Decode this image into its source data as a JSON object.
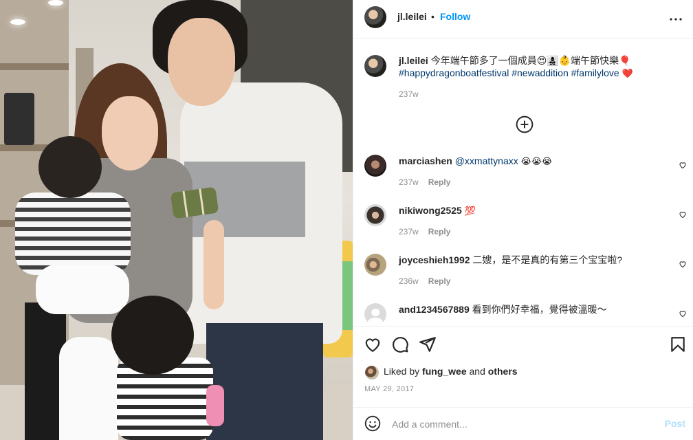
{
  "post": {
    "owner": "jl.leilei",
    "follow_label": "Follow",
    "dot": "•",
    "caption_user": "jl.leilei",
    "caption_text": "今年端午節多了一個成員😍👩‍👧‍👦👶端午節快樂🎈",
    "hashtags": "#happydragonboatfestival #newaddition #familylove",
    "caption_heart": "❤️",
    "caption_time": "237w",
    "likes_prefix": "Liked by",
    "liked_by": "fung_wee",
    "likes_and": "and",
    "likes_others": "others",
    "date": "MAY 29, 2017",
    "comment_placeholder": "Add a comment...",
    "post_label": "Post"
  },
  "comments": [
    {
      "user": "marciashen",
      "mention": "@xxmattynaxx",
      "text": "",
      "emoji": "😭😭😭",
      "time": "237w",
      "reply": "Reply"
    },
    {
      "user": "nikiwong2525",
      "mention": "",
      "text": "",
      "emoji": "💯",
      "time": "237w",
      "reply": "Reply"
    },
    {
      "user": "joyceshieh1992",
      "mention": "",
      "text": "二嫂，是不是真的有第三个宝宝啦?",
      "emoji": "",
      "time": "236w",
      "reply": "Reply"
    },
    {
      "user": "and1234567889",
      "mention": "",
      "text": "看到你們好幸福，覺得被溫暖～",
      "emoji": "",
      "time": "",
      "reply": ""
    }
  ],
  "icons": {
    "more": "more-options-icon",
    "load_more": "load-more-comments-icon",
    "like": "heart-icon",
    "comment": "comment-icon",
    "share": "share-icon",
    "save": "bookmark-icon",
    "emoji": "emoji-icon"
  },
  "colors": {
    "link": "#0095f6",
    "hashtag": "#00376b",
    "muted": "#8e8e8e",
    "post_disabled": "#b2dffc",
    "heart_red": "#ed4956"
  }
}
